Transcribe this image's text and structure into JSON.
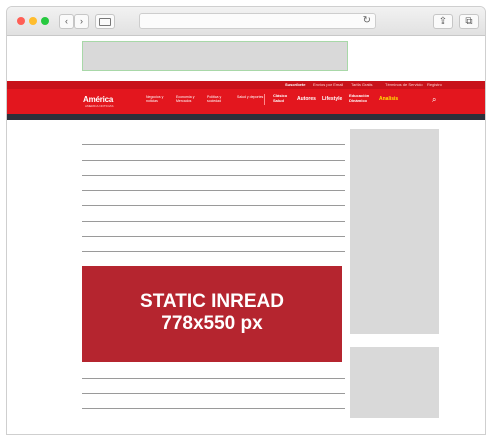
{
  "colors": {
    "brand_red": "#e3161e",
    "inread_red": "#b5252f",
    "placeholder_gray": "#d9d9d9",
    "dark_bar": "#2e2f3a"
  },
  "window": {
    "traffic_lights": [
      {
        "name": "close",
        "color": "#ff5f56"
      },
      {
        "name": "minimize",
        "color": "#ffbd2e"
      },
      {
        "name": "zoom",
        "color": "#27c93f"
      }
    ],
    "back_icon": "‹",
    "forward_icon": "›",
    "reload_icon": "↻",
    "share_icon": "⇪",
    "tabs_icon": "⧉"
  },
  "header": {
    "utility_links": [
      "Suscríbete",
      "Envíos por Email",
      "Tarifa Gratis",
      "Términos de Servicio",
      "Registro"
    ],
    "logo": "América",
    "logo_sub": "AMERICA NOTICIAS",
    "nav_items": [
      "Negocios y noticias",
      "Economía y Mercados",
      "Política y sociedad",
      "Salud y deportes"
    ],
    "brand_links": [
      "Clásico Salud",
      "Autores",
      "Lifestyle",
      "Educación Dinámico"
    ],
    "highlight_link": "Analisis",
    "search_icon": "⌕"
  },
  "inread_ad": {
    "line1": "STATIC INREAD",
    "line2": "778x550 px"
  }
}
